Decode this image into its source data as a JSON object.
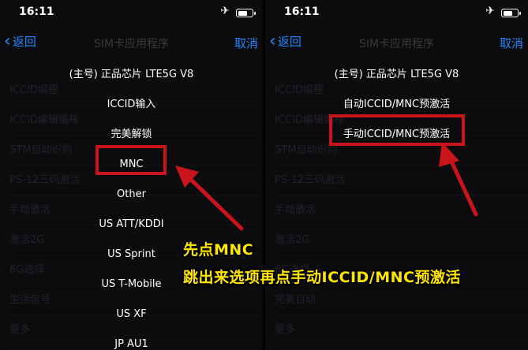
{
  "status": {
    "time": "16:11"
  },
  "nav": {
    "back_label": "返回",
    "title": "SIM卡应用程序",
    "cancel_label": "取消"
  },
  "left_background_rows": [
    "ICCID编程",
    "ICCID编辑编程",
    "STM自动识别",
    "PS-12三码激活",
    "手动激活",
    "激活2G",
    "6G选择",
    "生活信号",
    "更多"
  ],
  "right_background_rows": [
    "ICCID编程",
    "ICCID编辑编程",
    "STM自动识别",
    "PS-12三码激活",
    "手动激活",
    "激活2G",
    "6G选择",
    "完美自动",
    "更多"
  ],
  "left_menu": {
    "header": "(主号) 正品芯片 LTE5G V8",
    "items": [
      "ICCID输入",
      "完美解锁",
      "MNC",
      "Other",
      "US ATT/KDDI",
      "US Sprint",
      "US T-Mobile",
      "US XF",
      "JP AU1"
    ]
  },
  "right_menu": {
    "header": "(主号) 正品芯片 LTE5G V8",
    "items": [
      "自动ICCID/MNC预激活",
      "手动ICCID/MNC预激活"
    ]
  },
  "annotation": {
    "line1": "先点MNC",
    "line2": "跳出来选项再点手动ICCID/MNC预激活",
    "text_color": "#ffe600",
    "highlight_color": "#c8141a"
  },
  "icons": {
    "airplane": "✈",
    "back_chevron": "‹"
  }
}
